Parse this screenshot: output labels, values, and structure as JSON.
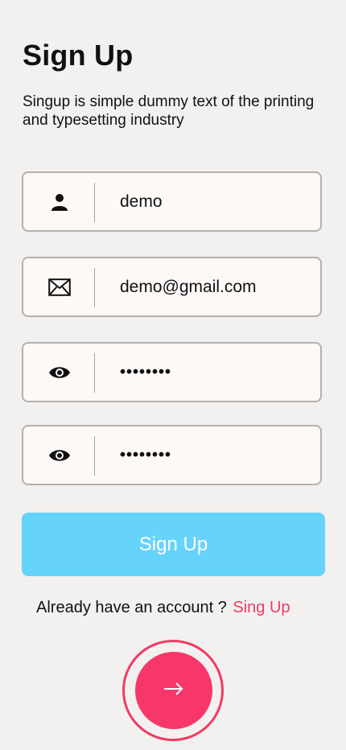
{
  "header": {
    "title": "Sign Up",
    "subtitle": "Singup is simple dummy text of the printing and typesetting industry"
  },
  "fields": {
    "username": {
      "value": "demo",
      "icon": "user-icon"
    },
    "email": {
      "value": "demo@gmail.com",
      "icon": "envelope-icon"
    },
    "password": {
      "value": "••••••••",
      "icon": "eye-icon"
    },
    "confirm_password": {
      "value": "••••••••",
      "icon": "eye-icon"
    }
  },
  "signup_button": {
    "label": "Sign Up"
  },
  "account_prompt": {
    "text": "Already have an account ?",
    "link": "Sing Up"
  },
  "next_button": {
    "icon": "arrow-right-icon"
  },
  "colors": {
    "accent": "#f7376a",
    "button": "#66d3fb",
    "background": "#f2f1ef",
    "field": "#fdf9f7"
  }
}
